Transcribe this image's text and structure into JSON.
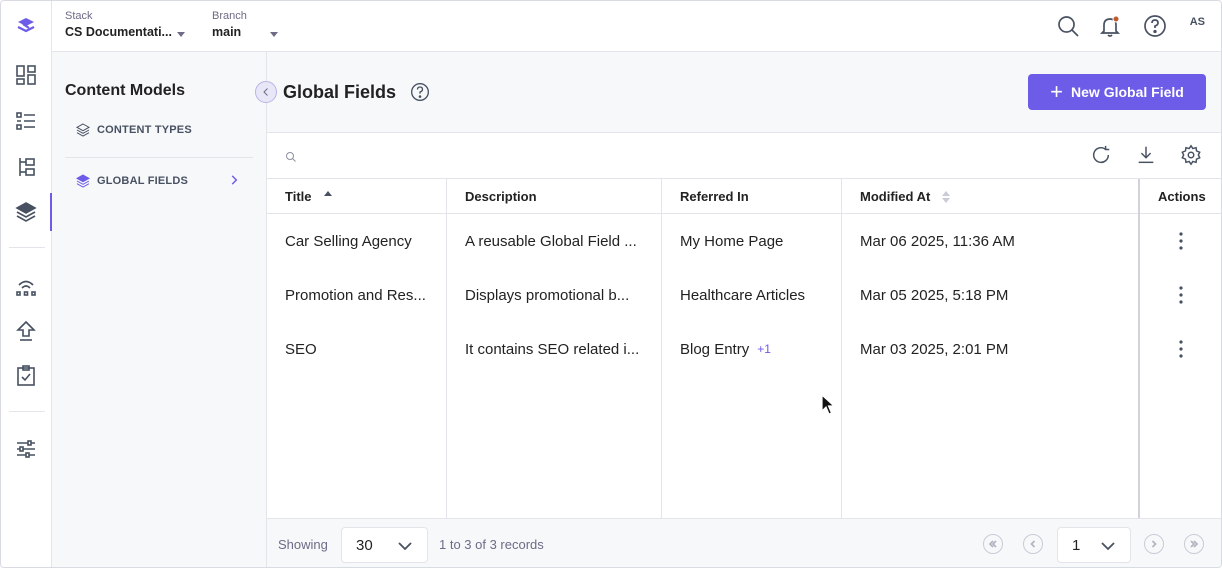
{
  "header": {
    "stack_label": "Stack",
    "stack_value": "CS Documentati...",
    "branch_label": "Branch",
    "branch_value": "main",
    "avatar_initials": "AS"
  },
  "content_models": {
    "title": "Content Models",
    "items": [
      {
        "label": "CONTENT TYPES",
        "icon": "layers-icon",
        "active": false
      },
      {
        "label": "GLOBAL FIELDS",
        "icon": "layers-filled-icon",
        "active": true
      }
    ]
  },
  "main": {
    "title": "Global Fields",
    "new_button_label": "New Global Field"
  },
  "table": {
    "columns": [
      "Title",
      "Description",
      "Referred In",
      "Modified At",
      "Actions"
    ],
    "rows": [
      {
        "title": "Car Selling Agency",
        "description": "A reusable Global Field ...",
        "referred_in": "My Home Page",
        "referred_extra": "",
        "modified_at": "Mar 06 2025, 11:36 AM"
      },
      {
        "title": "Promotion and Res...",
        "description": "Displays promotional b...",
        "referred_in": "Healthcare Articles",
        "referred_extra": "",
        "modified_at": "Mar 05 2025, 5:18 PM"
      },
      {
        "title": "SEO",
        "description": "It contains SEO related i...",
        "referred_in": "Blog Entry",
        "referred_extra": "+1",
        "modified_at": "Mar 03 2025, 2:01 PM"
      }
    ]
  },
  "footer": {
    "showing_label": "Showing",
    "per_page": "30",
    "records_text": "1 to 3 of 3 records",
    "page": "1"
  },
  "colors": {
    "accent": "#6c5ce7",
    "icon": "#475161",
    "border": "#e3e5ea"
  }
}
